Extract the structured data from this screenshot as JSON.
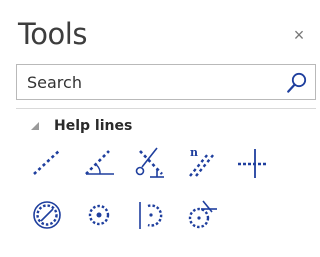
{
  "panel": {
    "title": "Tools",
    "close_glyph": "×"
  },
  "search": {
    "placeholder": "Search",
    "icon": "search-icon"
  },
  "group": {
    "label": "Help lines",
    "expanded": true,
    "tools": [
      {
        "name": "help-line-icon"
      },
      {
        "name": "angled-help-line-icon"
      },
      {
        "name": "perpendicular-help-line-icon"
      },
      {
        "name": "parallel-help-line-icon"
      },
      {
        "name": "horizontal-vertical-help-lines-icon"
      },
      {
        "name": "help-circle-icon"
      },
      {
        "name": "circle-center-icon"
      },
      {
        "name": "arc-help-line-icon"
      },
      {
        "name": "tangent-circle-icon"
      }
    ]
  },
  "colors": {
    "accent": "#1f3f9e",
    "text": "#3d3d3d",
    "border": "#b9b9b9"
  }
}
